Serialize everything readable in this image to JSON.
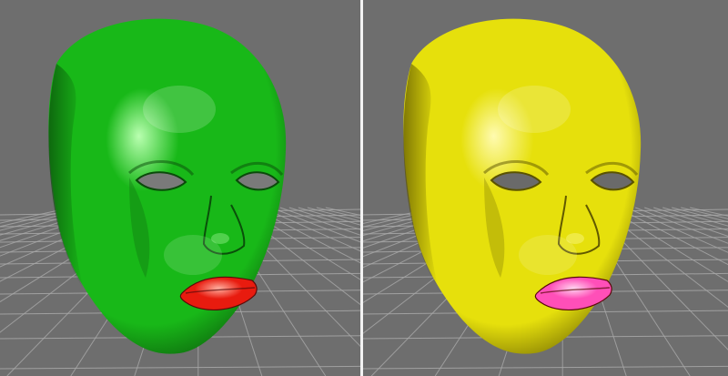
{
  "scene": {
    "background_color": "#6e6e6e",
    "grid_color": "#a9a9a9",
    "divider_color": "#f2f2f2"
  },
  "viewports": [
    {
      "id": "left",
      "model": "face-head-mesh",
      "skin_color": "#18b818",
      "skin_highlight": "#b9ffb0",
      "skin_shadow": "#0a4a0a",
      "lip_color": "#e81b0f",
      "lip_highlight": "#ffb0a0",
      "eye_color": "#7a7a7a"
    },
    {
      "id": "right",
      "model": "face-head-mesh",
      "skin_color": "#e6e00c",
      "skin_highlight": "#fffbb0",
      "skin_shadow": "#5a5200",
      "lip_color": "#ff4fb8",
      "lip_highlight": "#ffd6f0",
      "eye_color": "#6a6a6a"
    }
  ]
}
